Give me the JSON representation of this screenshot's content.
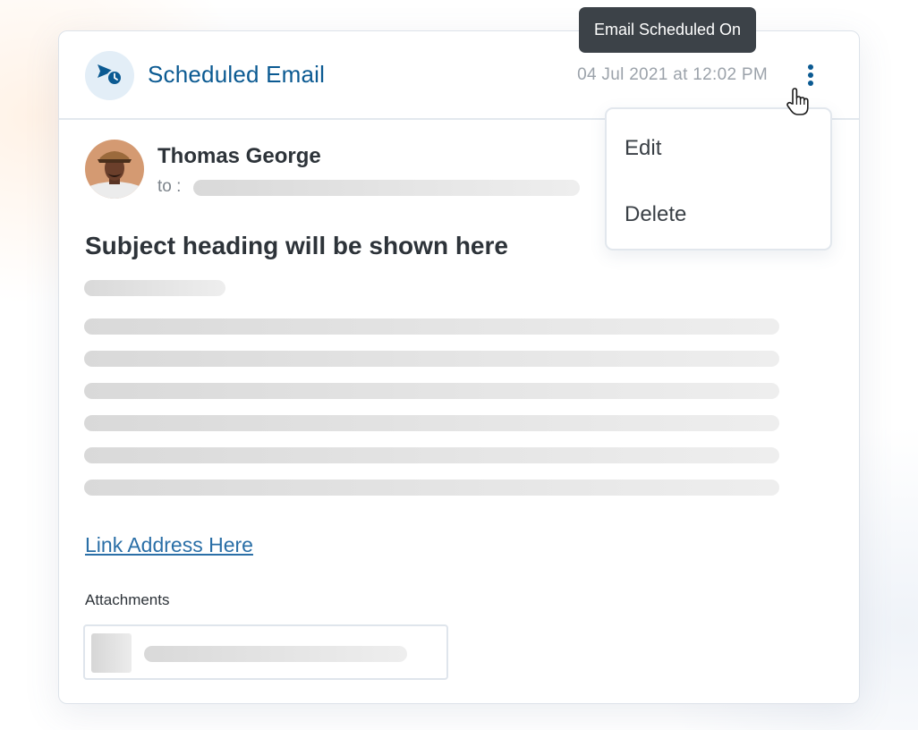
{
  "header": {
    "icon": "scheduled-send-icon",
    "title": "Scheduled Email",
    "date": "04 Jul 2021 at 12:02 PM",
    "menu_icon": "kebab-menu-icon"
  },
  "tooltip": {
    "text": "Email Scheduled On"
  },
  "menu": {
    "items": [
      {
        "label": "Edit"
      },
      {
        "label": "Delete"
      }
    ]
  },
  "sender": {
    "name": "Thomas George",
    "to_label": "to :",
    "avatar": "user-avatar"
  },
  "email": {
    "subject": "Subject heading will be shown here",
    "link_text": "Link Address Here",
    "attachments_label": "Attachments"
  },
  "colors": {
    "accent": "#0b5a92",
    "link": "#2a6fa7",
    "tooltip_bg": "#3c4248",
    "placeholder": "#dcdcdc"
  }
}
